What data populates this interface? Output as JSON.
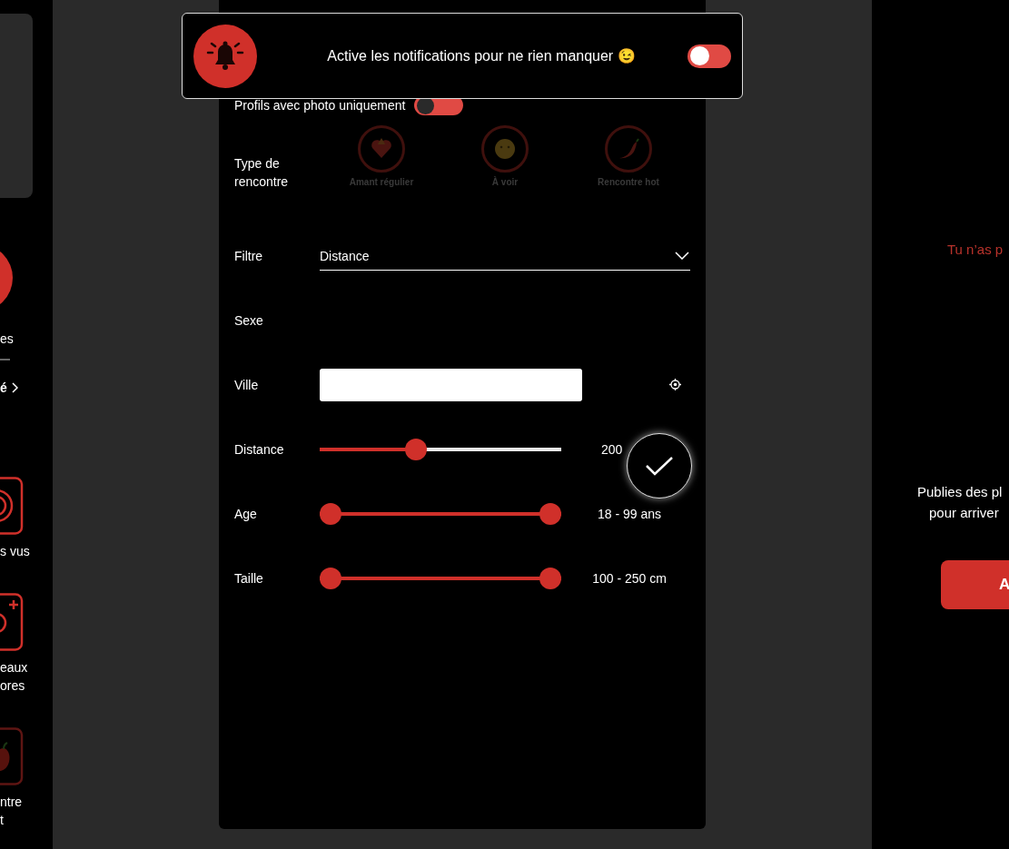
{
  "sidebar": {
    "items": [
      {
        "kind": "avatar",
        "lines": [
          "es"
        ]
      },
      {
        "kind": "link",
        "lines": [
          "é"
        ]
      },
      {
        "kind": "tile",
        "dimmed": false,
        "lines": [
          "s vus"
        ]
      },
      {
        "kind": "tile",
        "dimmed": false,
        "lines": [
          "eaux",
          "ores"
        ]
      },
      {
        "kind": "tile",
        "dimmed": true,
        "lines": [
          "ntre",
          "t"
        ]
      }
    ]
  },
  "notification": {
    "text": "Active les notifications pour ne rien manquer 😉",
    "on": false
  },
  "filters": {
    "rows": [
      {
        "kind": "toggle",
        "label": "Profils avec photo uniquement",
        "on": false
      },
      {
        "kind": "types",
        "label": "Type de rencontre",
        "options": [
          {
            "label": "Amant régulier",
            "selected": false
          },
          {
            "label": "À voir",
            "selected": false
          },
          {
            "label": "Rencontre hot",
            "selected": false
          }
        ]
      },
      {
        "kind": "select",
        "label": "Filtre",
        "value": "Distance"
      },
      {
        "kind": "empty",
        "label": "Sexe"
      },
      {
        "kind": "text_input",
        "label": "Ville"
      },
      {
        "kind": "slider",
        "label": "Distance",
        "level": 0.4,
        "reading": "200"
      },
      {
        "kind": "range",
        "label": "Age",
        "level": 1,
        "reading": "18 - 99 ans"
      },
      {
        "kind": "range",
        "label": "Taille",
        "level": 1,
        "reading": "100 - 250 cm"
      }
    ]
  },
  "right_panel": {
    "notice": "Tu n’as p",
    "lines": [
      "Publies des pl",
      "pour arriver"
    ],
    "button": "A"
  }
}
